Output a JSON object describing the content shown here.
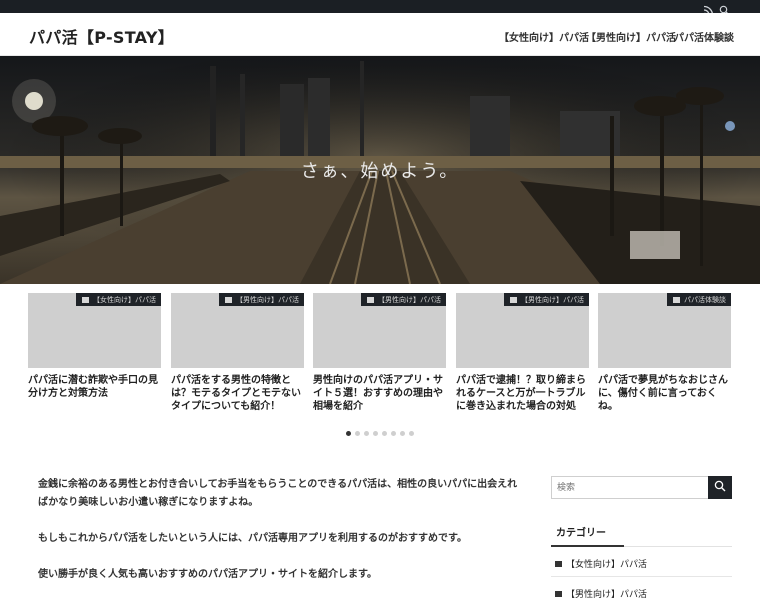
{
  "topbar": {
    "icons": [
      "rss-icon",
      "search-icon"
    ]
  },
  "header": {
    "site_title": "パパ活【P-STAY】"
  },
  "nav": {
    "items": [
      {
        "label": "【女性向け】パパ活"
      },
      {
        "label": "【男性向け】パパ活"
      },
      {
        "label": "パパ活体験談"
      }
    ]
  },
  "hero": {
    "tagline": "さぁ、始めよう。"
  },
  "cards": [
    {
      "category": "【女性向け】パパ活",
      "title": "パパ活に潜む詐欺や手口の見分け方と対策方法"
    },
    {
      "category": "【男性向け】パパ活",
      "title": "パパ活をする男性の特徴とは？モテるタイプとモテないタイプについても紹介！"
    },
    {
      "category": "【男性向け】パパ活",
      "title": "男性向けのパパ活アプリ・サイト５選！おすすめの理由や相場を紹介"
    },
    {
      "category": "【男性向け】パパ活",
      "title": "パパ活で逮捕！？取り締まられるケースと万が一トラブルに巻き込まれた場合の対処"
    },
    {
      "category": "パパ活体験談",
      "title": "パパ活で夢見がちなおじさんに、傷付く前に言っておくね。"
    }
  ],
  "slider": {
    "dot_count": 8,
    "active_index": 0
  },
  "main": {
    "paragraphs": [
      "金銭に余裕のある男性とお付き合いしてお手当をもらうことのできるパパ活は、相性の良いパパに出会えればかなり美味しいお小遣い稼ぎになりますよね。",
      "もしもこれからパパ活をしたいという人には、パパ活専用アプリを利用するのがおすすめです。",
      "使い勝手が良く人気も高いおすすめのパパ活アプリ・サイトを紹介します。"
    ]
  },
  "sidebar": {
    "search_placeholder": "検索",
    "category_title": "カテゴリー",
    "categories": [
      {
        "label": "【女性向け】パパ活"
      },
      {
        "label": "【男性向け】パパ活"
      }
    ]
  }
}
